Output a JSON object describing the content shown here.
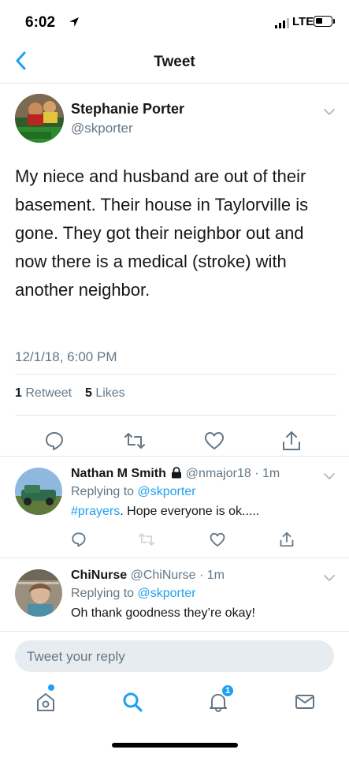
{
  "status_bar": {
    "time": "6:02",
    "network": "LTE"
  },
  "nav": {
    "title": "Tweet"
  },
  "main_tweet": {
    "author_name": "Stephanie Porter",
    "author_handle": "@skporter",
    "text": "My niece and husband are out of their basement. Their house in Taylorville is gone. They got their neighbor out and now there is a medical (stroke) with another neighbor.",
    "timestamp": "12/1/18, 6:00 PM",
    "retweet_count": "1",
    "retweet_label": "Retweet",
    "like_count": "5",
    "like_label": "Likes"
  },
  "replies": [
    {
      "name": "Nathan M Smith",
      "handle": "@nmajor18",
      "time": "1m",
      "replying_label": "Replying to",
      "replying_handle": "@skporter",
      "hashtag": "#prayers",
      "text": ". Hope everyone is ok....."
    },
    {
      "name": "ChiNurse",
      "handle": "@ChiNurse",
      "time": "1m",
      "replying_label": "Replying to",
      "replying_handle": "@skporter",
      "text": "Oh thank goodness they’re okay!"
    }
  ],
  "composer": {
    "placeholder": "Tweet your reply"
  },
  "tab_bar": {
    "notification_count": "1"
  },
  "colors": {
    "accent": "#1da1f2",
    "text": "#14171a",
    "muted": "#657786",
    "divider": "#e1e8ed"
  }
}
